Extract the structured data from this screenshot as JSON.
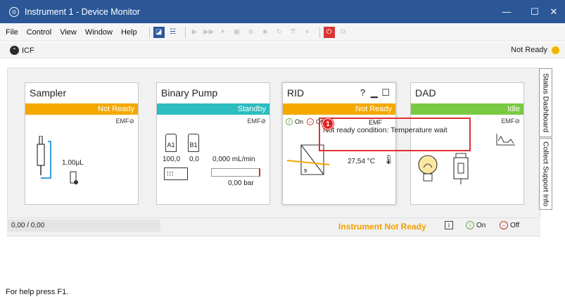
{
  "window": {
    "title": "Instrument 1 - Device Monitor",
    "minimize": "—",
    "maximize": "☐",
    "close": "✕"
  },
  "menu": [
    "File",
    "Control",
    "View",
    "Window",
    "Help"
  ],
  "status_line": {
    "section": "ICF",
    "status": "Not Ready"
  },
  "modules": {
    "sampler": {
      "title": "Sampler",
      "state": "Not Ready",
      "emf": "EMF",
      "volume": "1,00µL"
    },
    "pump": {
      "title": "Binary Pump",
      "state": "Standby",
      "emf": "EMF",
      "label_a": "A1",
      "label_b": "B1",
      "pct_a": "100,0",
      "pct_b": "0,0",
      "flow": "0,000 mL/min",
      "pressure": "0,00 bar"
    },
    "rid": {
      "title": "RID",
      "help": "?",
      "state": "Not Ready",
      "on": "On",
      "off": "Off",
      "temperature": "27,54 °C",
      "cell_label": "s",
      "emf_partial": "EMF"
    },
    "dad": {
      "title": "DAD",
      "state": "Idle",
      "emf": "EMF"
    }
  },
  "tooltip": {
    "badge": "1",
    "text": "Not ready condition: Temperature wait"
  },
  "bottom": {
    "progress": "0,00 / 0,00",
    "instrument_status": "Instrument Not Ready",
    "info": "i",
    "on": "On",
    "off": "Off"
  },
  "side_tabs": {
    "status_dashboard": "Status Dashboard",
    "collect_support": "Collect Support Info"
  },
  "footer": {
    "help": "For help press F1."
  },
  "colors": {
    "title_bar": "#2b5797",
    "not_ready": "#f5a800",
    "standby": "#2bbdbf",
    "idle": "#7ac943",
    "highlight": "#e03030"
  }
}
